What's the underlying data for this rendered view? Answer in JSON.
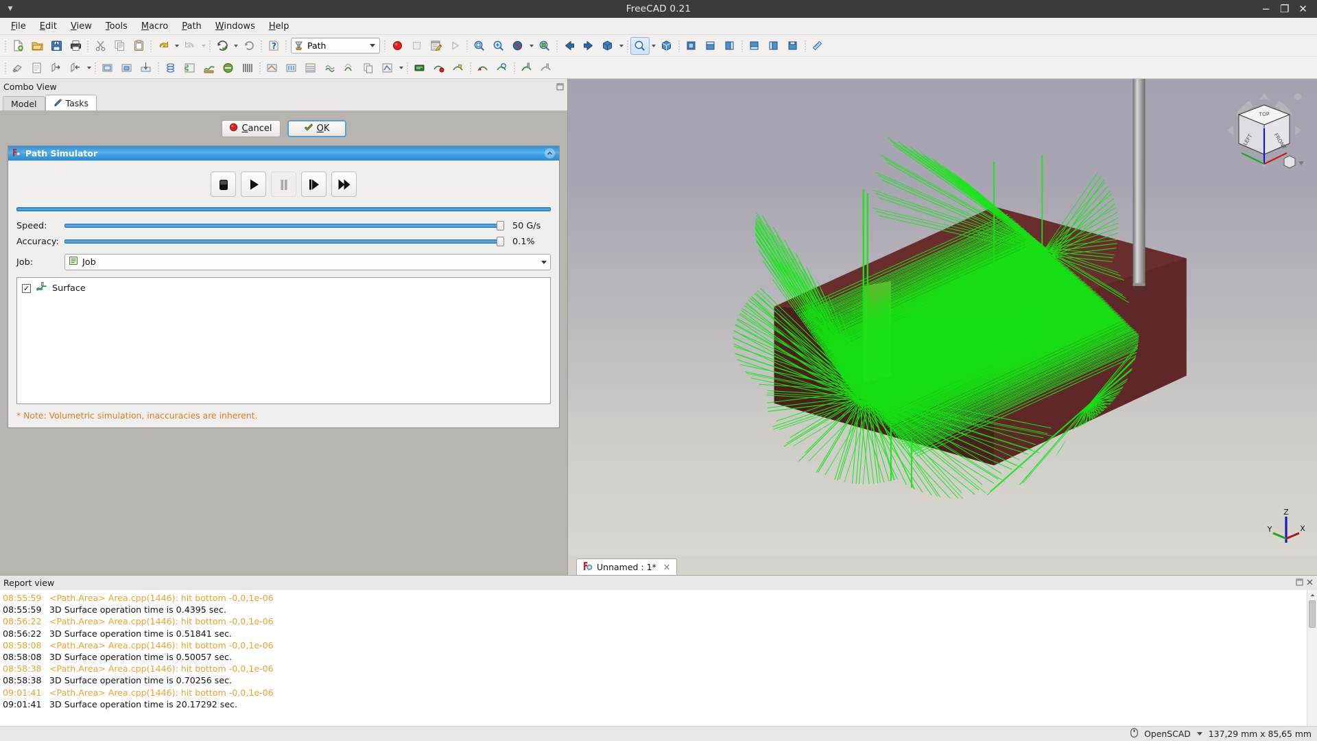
{
  "window": {
    "title": "FreeCAD 0.21",
    "buttons": {
      "minimize": "−",
      "maximize": "❐",
      "close": "✕"
    }
  },
  "menubar": {
    "items": [
      {
        "label": "File",
        "mnemonic": "F"
      },
      {
        "label": "Edit",
        "mnemonic": "E"
      },
      {
        "label": "View",
        "mnemonic": "V"
      },
      {
        "label": "Tools",
        "mnemonic": "T"
      },
      {
        "label": "Macro",
        "mnemonic": "M"
      },
      {
        "label": "Path",
        "mnemonic": "P"
      },
      {
        "label": "Windows",
        "mnemonic": "W"
      },
      {
        "label": "Help",
        "mnemonic": "H"
      }
    ]
  },
  "toolbar": {
    "workbench_selector": {
      "value": "Path",
      "icon": "path-workbench-icon"
    },
    "row1_icons": [
      "new-document-icon",
      "open-folder-icon",
      "save-icon",
      "print-icon",
      "cut-scissors-icon",
      "copy-icon",
      "paste-icon",
      "undo-arrow-icon",
      "redo-arrow-icon",
      "refresh-icon",
      "refresh-circle-icon",
      "whats-this-icon"
    ],
    "macro_icons": [
      "macro-record-icon",
      "macro-stop-icon",
      "macro-edit-icon",
      "macro-execute-icon"
    ],
    "view_icons": [
      "fit-all-icon",
      "zoom-box-icon",
      "draw-style-icon",
      "zoom-selection-icon",
      "back-arrow-icon",
      "forward-arrow-icon",
      "view-isometric-icon",
      "select-pick-icon",
      "axonometric-icon",
      "view-front-icon",
      "view-top-icon",
      "view-right-icon",
      "view-rear-icon",
      "view-bottom-icon",
      "view-left-icon",
      "measure-icon"
    ],
    "row2_icons": [
      "path-job-icon",
      "path-post-icon",
      "path-export-icon",
      "path-import-icon",
      "path-profile-icon",
      "path-pocket-icon",
      "path-drilling-icon",
      "path-helix-icon",
      "path-adaptive-icon",
      "path-surface-icon",
      "path-slot-icon",
      "path-engrave-icon",
      "path-deburr-icon",
      "path-vcarve-icon",
      "path-waterline-icon",
      "path-array-icon",
      "path-copy-icon",
      "path-simple-copy-icon",
      "path-dressup-icon",
      "path-comment-icon",
      "path-stop-icon",
      "path-custom-icon",
      "path-probe-icon",
      "path-inspect-icon",
      "path-simulator-icon",
      "path-sanity-icon",
      "path-toolbit-library-icon",
      "path-toolcontroller-icon"
    ]
  },
  "combo_view": {
    "title": "Combo View",
    "tabs": [
      {
        "label": "Model",
        "icon": "model-tree-icon",
        "active": false
      },
      {
        "label": "Tasks",
        "icon": "pencil-icon",
        "active": true
      }
    ]
  },
  "task_dialog": {
    "cancel_label": "Cancel",
    "cancel_mnemonic": "C",
    "ok_label": "OK",
    "ok_mnemonic": "O"
  },
  "path_simulator": {
    "title": "Path Simulator",
    "icon": "freecad-gear-icon",
    "transport": [
      {
        "name": "stop-button",
        "label": "Stop",
        "enabled": true
      },
      {
        "name": "play-button",
        "label": "Play",
        "enabled": true
      },
      {
        "name": "pause-button",
        "label": "Pause",
        "enabled": false
      },
      {
        "name": "step-button",
        "label": "Step",
        "enabled": true
      },
      {
        "name": "fast-forward-button",
        "label": "Fast Forward",
        "enabled": true
      }
    ],
    "progress": {
      "value": 100,
      "max": 100
    },
    "speed": {
      "label": "Speed:",
      "value_text": "50 G/s",
      "percent": 100
    },
    "accuracy": {
      "label": "Accuracy:",
      "value_text": "0.1%",
      "percent": 100
    },
    "job": {
      "label": "Job:",
      "value": "Job",
      "icon": "job-icon"
    },
    "operations": [
      {
        "label": "Surface",
        "checked": true,
        "icon": "surface-op-icon"
      }
    ],
    "note": "* Note: Volumetric simulation, inaccuracies are inherent."
  },
  "viewport": {
    "navcube": {
      "faces": {
        "top": "TOP",
        "left": "LEFT",
        "front": "FRONT"
      }
    },
    "axis_indicator": {
      "x": "X",
      "y": "Y",
      "z": "Z"
    },
    "model": {
      "toolpath_color": "#14e814",
      "stock_color": "#5a2424",
      "tool_color": "#9a9a9a"
    }
  },
  "view_tabs": [
    {
      "label": "Unnamed : 1*",
      "icon": "freecad-gear-icon",
      "close": "✕",
      "active": true
    }
  ],
  "report_view": {
    "title": "Report view",
    "lines": [
      {
        "time": "08:55:59",
        "text": "<Path.Area> Area.cpp(1446): hit bottom -0,0,1e-06",
        "level": "warning"
      },
      {
        "time": "08:55:59",
        "text": "3D Surface operation time is 0.4395 sec.",
        "level": "normal"
      },
      {
        "time": "08:56:22",
        "text": "<Path.Area> Area.cpp(1446): hit bottom -0,0,1e-06",
        "level": "warning"
      },
      {
        "time": "08:56:22",
        "text": "3D Surface operation time is 0.51841 sec.",
        "level": "normal"
      },
      {
        "time": "08:58:08",
        "text": "<Path.Area> Area.cpp(1446): hit bottom -0,0,1e-06",
        "level": "warning"
      },
      {
        "time": "08:58:08",
        "text": "3D Surface operation time is 0.50057 sec.",
        "level": "normal"
      },
      {
        "time": "08:58:38",
        "text": "<Path.Area> Area.cpp(1446): hit bottom -0,0,1e-06",
        "level": "warning"
      },
      {
        "time": "08:58:38",
        "text": "3D Surface operation time is 0.70256 sec.",
        "level": "normal"
      },
      {
        "time": "09:01:41",
        "text": "<Path.Area> Area.cpp(1446): hit bottom -0,0,1e-06",
        "level": "warning"
      },
      {
        "time": "09:01:41",
        "text": "3D Surface operation time is 20.17292 sec.",
        "level": "normal"
      }
    ]
  },
  "statusbar": {
    "navigation_style": "OpenSCAD",
    "navigation_icon": "mouse-icon",
    "dimensions": "137,29 mm x 85,65 mm"
  },
  "colors": {
    "accent_blue": "#3d97d8",
    "group_header": "#4aa6e3",
    "warning_orange": "#f0a22e",
    "note_orange": "#e07b20",
    "toolpath_green": "#14e814"
  }
}
